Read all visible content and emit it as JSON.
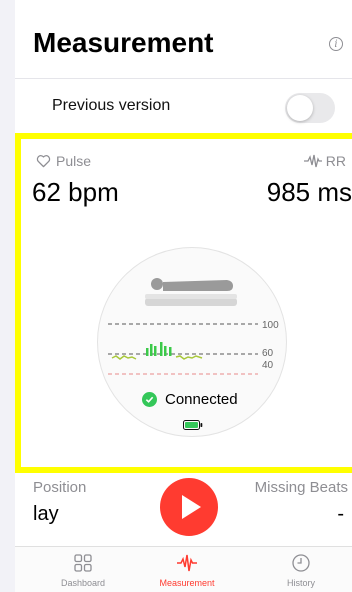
{
  "header": {
    "title": "Measurement",
    "info_icon": "info-circle-icon"
  },
  "settings": {
    "previous_version_label": "Previous version",
    "previous_version_enabled": false
  },
  "live": {
    "pulse_label": "Pulse",
    "pulse_icon": "heart-outline-icon",
    "pulse_value": "62 bpm",
    "rr_label": "RR",
    "rr_icon": "waveform-icon",
    "rr_value": "985 ms",
    "position_icon": "person-lying-icon",
    "chart_ticks": [
      "100",
      "60",
      "40"
    ],
    "status_text": "Connected",
    "status_icon": "checkmark-circle-icon",
    "battery_icon": "battery-icon"
  },
  "summary": {
    "position_label": "Position",
    "position_value": "lay",
    "missing_label": "Missing Beats",
    "missing_value": "-",
    "record_icon": "play-icon"
  },
  "tabs": [
    {
      "label": "Dashboard",
      "icon": "grid-icon"
    },
    {
      "label": "Measurement",
      "icon": "waveform-icon"
    },
    {
      "label": "History",
      "icon": "clock-icon"
    }
  ],
  "colors": {
    "accent": "#ff3b30",
    "highlight": "#ffff00",
    "connected": "#34c759",
    "toggle_off": "#e9e9eb"
  }
}
